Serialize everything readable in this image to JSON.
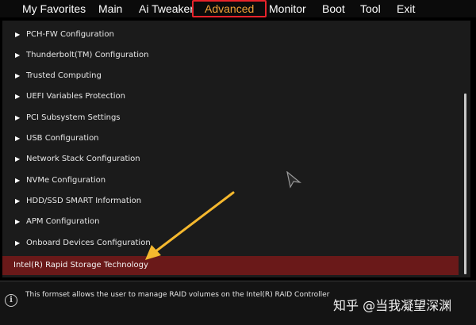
{
  "menu": {
    "tabs": [
      {
        "label": "My Favorites"
      },
      {
        "label": "Main"
      },
      {
        "label": "Ai Tweaker"
      },
      {
        "label": "Advanced"
      },
      {
        "label": "Monitor"
      },
      {
        "label": "Boot"
      },
      {
        "label": "Tool"
      },
      {
        "label": "Exit"
      }
    ],
    "active_tab": "Advanced"
  },
  "items": [
    {
      "label": "PCH-FW Configuration"
    },
    {
      "label": "Thunderbolt(TM) Configuration"
    },
    {
      "label": "Trusted Computing"
    },
    {
      "label": "UEFI Variables Protection"
    },
    {
      "label": "PCI Subsystem Settings"
    },
    {
      "label": "USB Configuration"
    },
    {
      "label": "Network Stack Configuration"
    },
    {
      "label": "NVMe Configuration"
    },
    {
      "label": "HDD/SSD SMART Information"
    },
    {
      "label": "APM Configuration"
    },
    {
      "label": "Onboard Devices Configuration"
    },
    {
      "label": "Intel(R) Rapid Storage Technology"
    }
  ],
  "selected_item": "Intel(R) Rapid Storage Technology",
  "help": {
    "text": "This formset allows the user to manage RAID volumes on the Intel(R) RAID Controller"
  },
  "watermark": {
    "text": "知乎 @当我凝望深渊"
  },
  "colors": {
    "active_tab_border": "#e8232b",
    "active_tab_text": "#f2a33a",
    "selected_row": "#6a1919",
    "annotation_arrow": "#f5b82e"
  }
}
